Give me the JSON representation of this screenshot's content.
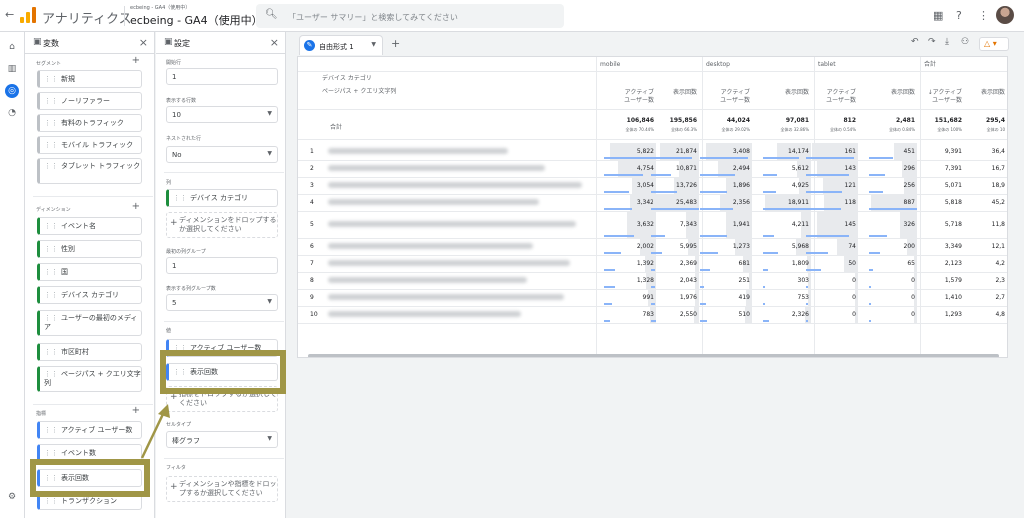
{
  "topbar": {
    "back": "←",
    "app_title": "アナリティクス",
    "property_path": "ecbeing - GA4（使用中）",
    "property_name": "ecbeing - GA4（使用中）",
    "search_placeholder": "「ユーザー サマリー」と検索してみてください",
    "search_icon": "search-icon",
    "icons": [
      "apps-icon",
      "help-icon",
      "more-vert-icon"
    ]
  },
  "rail": {
    "icons": [
      "home-icon",
      "reports-icon",
      "explore-icon",
      "advertising-icon"
    ],
    "settings_icon": "gear-icon"
  },
  "variables": {
    "title": "変数",
    "close": "×",
    "segment_label": "セグメント",
    "segments": [
      "新規",
      "ノーリファラー",
      "有料のトラフィック",
      "モバイル トラフィック",
      "タブレット トラフィック"
    ],
    "dimension_label": "ディメンション",
    "dimensions": [
      "イベント名",
      "性別",
      "国",
      "デバイス カテゴリ",
      "ユーザーの最初のメディア",
      "市区町村",
      "ページパス + クエリ文字列"
    ],
    "metric_label": "指標",
    "metrics": [
      "アクティブ ユーザー数",
      "イベント数",
      "表示回数",
      "トランザクション"
    ]
  },
  "settings": {
    "title": "設定",
    "close": "×",
    "start_row_label": "開始行",
    "start_row": "1",
    "show_rows_label": "表示する行数",
    "show_rows": "10",
    "nested_rows_label": "ネストされた行",
    "nested_rows": "No",
    "columns_label": "列",
    "column_chip": "デバイス カテゴリ",
    "drop_dimension": "ディメンションをドロップするか選択してください",
    "start_group_label": "最初の列グループ",
    "start_group": "1",
    "show_groups_label": "表示する列グループ数",
    "show_groups": "5",
    "values_label": "値",
    "value_chips": [
      "アクティブ ユーザー数",
      "表示回数"
    ],
    "drop_metric": "指標をドロップするか選択してください",
    "cell_type_label": "セルタイプ",
    "cell_type": "棒グラフ",
    "filter_label": "フィルタ",
    "drop_filter": "ディメンションや指標をドロップするか選択してください"
  },
  "canvas": {
    "tab_label": "自由形式 1",
    "add_tab": "+",
    "warn": "△ ▾",
    "actions": [
      "undo-icon",
      "redo-icon",
      "download-icon",
      "share-icon"
    ]
  },
  "table": {
    "col_dim_header": "デバイス カテゴリ",
    "row_dim_header": "ページパス + クエリ文字列",
    "total_label": "合計",
    "groups": [
      "mobile",
      "desktop",
      "tablet",
      "合計"
    ],
    "metric_headers": [
      "アクティブ\nユーザー数",
      "表示回数"
    ],
    "sorted_metric": "↓アクティブ\nユーザー数",
    "totals": [
      "106,846",
      "195,856",
      "44,024",
      "97,081",
      "812",
      "2,481",
      "151,682",
      "295,4"
    ],
    "percents": [
      "全体の 70.44%",
      "全体の 66.3%",
      "全体の 29.02%",
      "全体の 32.86%",
      "全体の 0.54%",
      "全体の 0.84%",
      "全体の 100%",
      "全体の 10"
    ],
    "rows": [
      {
        "n": "1",
        "v": [
          "5,822",
          "21,874",
          "3,408",
          "14,174",
          "161",
          "451",
          "9,391",
          "36,4"
        ]
      },
      {
        "n": "2",
        "v": [
          "4,754",
          "10,871",
          "2,494",
          "5,612",
          "143",
          "296",
          "7,391",
          "16,7"
        ]
      },
      {
        "n": "3",
        "v": [
          "3,054",
          "13,726",
          "1,896",
          "4,925",
          "121",
          "256",
          "5,071",
          "18,9"
        ]
      },
      {
        "n": "4",
        "v": [
          "3,342",
          "25,483",
          "2,356",
          "18,911",
          "118",
          "887",
          "5,818",
          "45,2"
        ]
      },
      {
        "n": "5",
        "v": [
          "3,632",
          "7,343",
          "1,941",
          "4,211",
          "145",
          "326",
          "5,718",
          "11,8"
        ]
      },
      {
        "n": "6",
        "v": [
          "2,002",
          "5,995",
          "1,273",
          "5,968",
          "74",
          "200",
          "3,349",
          "12,1"
        ]
      },
      {
        "n": "7",
        "v": [
          "1,392",
          "2,369",
          "681",
          "1,809",
          "50",
          "65",
          "2,123",
          "4,2"
        ]
      },
      {
        "n": "8",
        "v": [
          "1,328",
          "2,043",
          "251",
          "303",
          "0",
          "0",
          "1,579",
          "2,3"
        ]
      },
      {
        "n": "9",
        "v": [
          "991",
          "1,976",
          "419",
          "753",
          "0",
          "0",
          "1,410",
          "2,7"
        ]
      },
      {
        "n": "10",
        "v": [
          "783",
          "2,550",
          "510",
          "2,326",
          "0",
          "0",
          "1,293",
          "4,8"
        ]
      }
    ]
  }
}
